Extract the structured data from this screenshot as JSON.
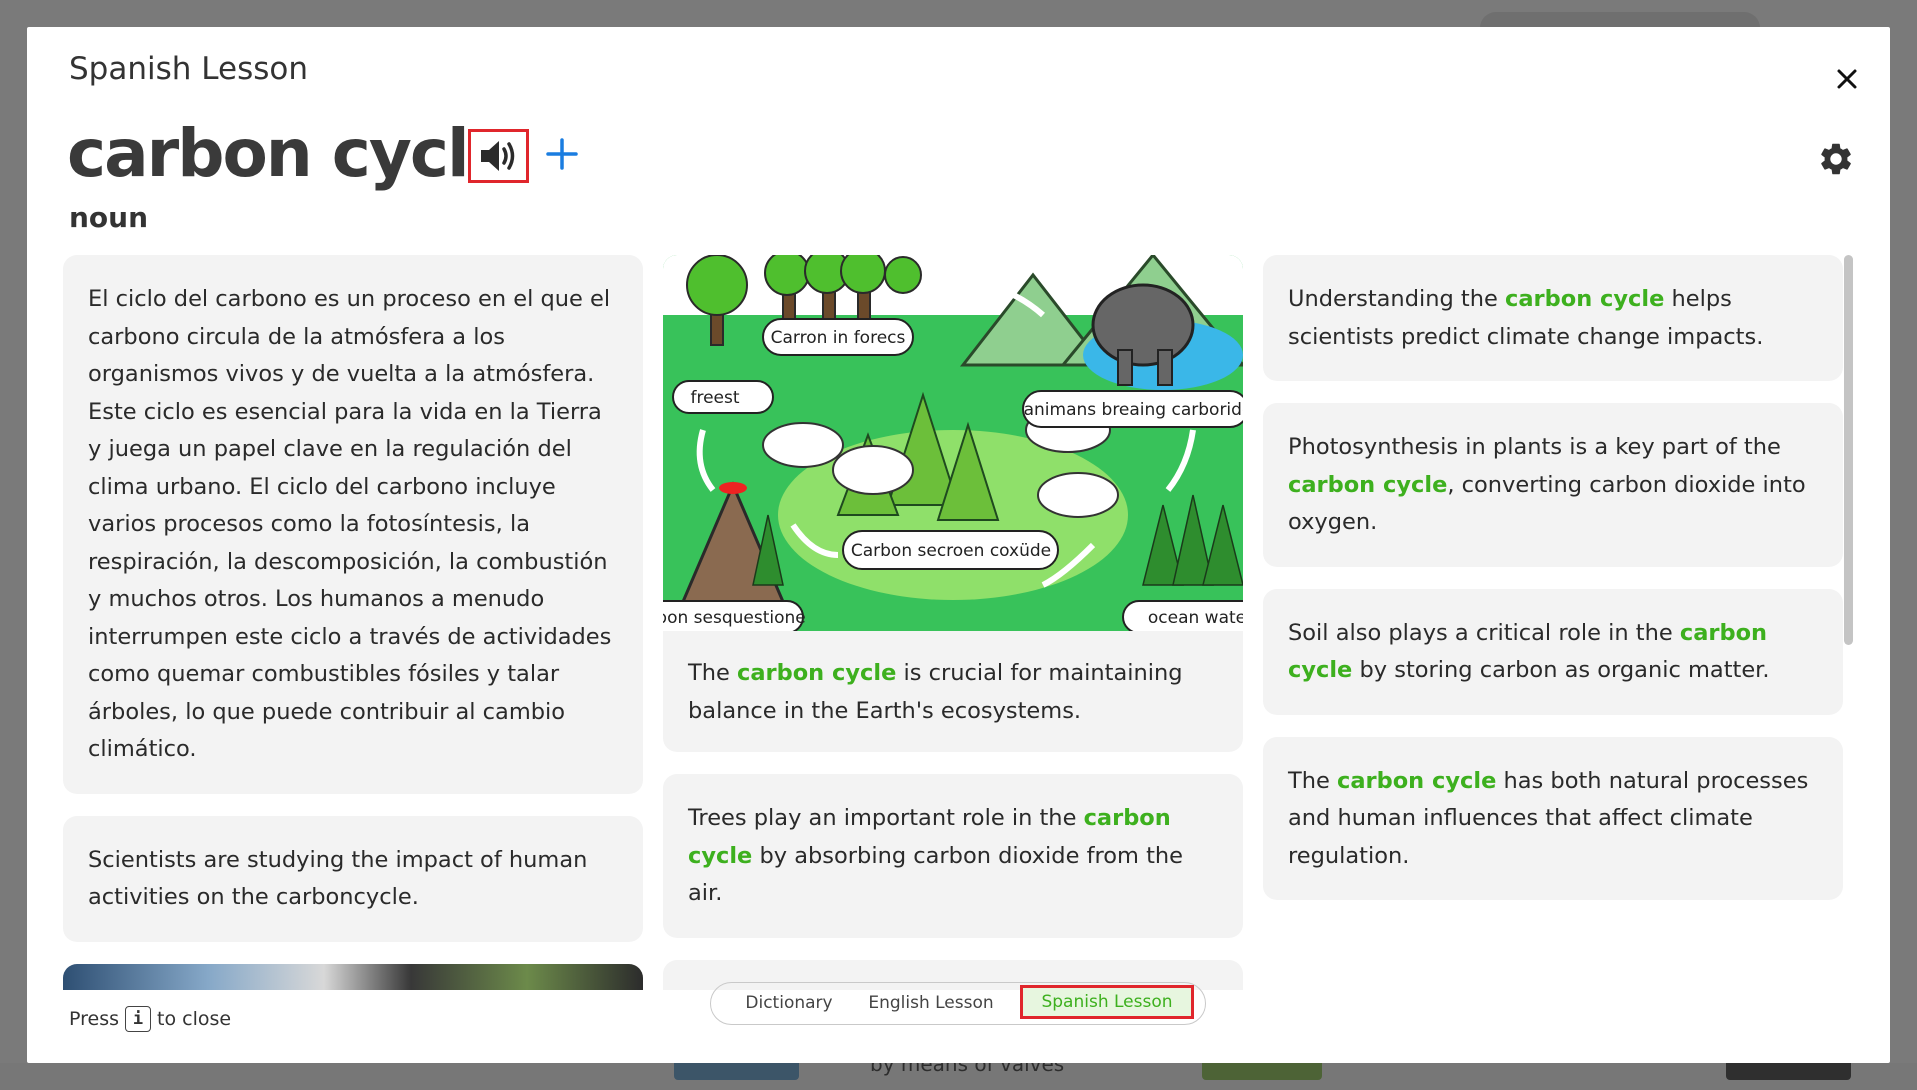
{
  "background": {
    "snippet": "by means of valves"
  },
  "modal": {
    "title": "Spanish Lesson",
    "close_label": "×",
    "word": "carbon cycle",
    "part_of_speech": "noun",
    "press_prefix": "Press",
    "press_key": "i",
    "press_suffix": "to close"
  },
  "columns": {
    "col1": {
      "definition": "El ciclo del carbono es un proceso en el que el carbono circula de la atmósfera a los organismos vivos y de vuelta a la atmósfera. Este ciclo es esencial para la vida en la Tierra y juega un papel clave en la regulación del clima urbano. El ciclo del carbono incluye varios procesos como la fotosíntesis, la respiración, la descomposición, la combustión y muchos otros. Los humanos a menudo interrumpen este ciclo a través de actividades como quemar combustibles fósiles y talar árboles, lo que puede contribuir al cambio climático.",
      "example": "Scientists are studying the impact of human activities on the carboncycle."
    },
    "col2": {
      "image_labels": {
        "forest_label": "Carron in forecs",
        "freest_label": "freest",
        "animals_label": "animans breaing carboride",
        "center_label": "Carbon secroen coxüde",
        "seq_label": "bon sesquestione",
        "ocean_label": "ocean wate"
      },
      "ex1": {
        "pre": "The ",
        "hl": "carbon cycle",
        "post": " is crucial for maintaining balance in the Earth's ecosystems."
      },
      "ex2": {
        "pre": "Trees play an important role in the ",
        "hl": "carbon cycle",
        "post": " by absorbing carbon dioxide from the air."
      }
    },
    "col3": {
      "ex1": {
        "pre": "Understanding the ",
        "hl": "carbon cycle",
        "post": " helps scientists predict climate change impacts."
      },
      "ex2": {
        "pre": "Photosynthesis in plants is a key part of the ",
        "hl": "carbon cycle",
        "post": ", converting carbon dioxide into oxygen."
      },
      "ex3": {
        "pre": "Soil also plays a critical role in the ",
        "hl": "carbon cycle",
        "post": " by storing carbon as organic matter."
      },
      "ex4": {
        "pre": "The ",
        "hl": "carbon cycle",
        "post": " has both natural processes and human influences that affect climate regulation."
      }
    }
  },
  "tabs": {
    "dictionary": "Dictionary",
    "english": "English Lesson",
    "spanish": "Spanish Lesson",
    "active": "Spanish Lesson"
  },
  "colors": {
    "highlight": "#3db01e",
    "active_tab_border": "#e0262c",
    "plus_icon": "#1a7de0"
  },
  "icons": [
    "close-icon",
    "speaker-icon",
    "plus-icon",
    "gear-icon"
  ]
}
